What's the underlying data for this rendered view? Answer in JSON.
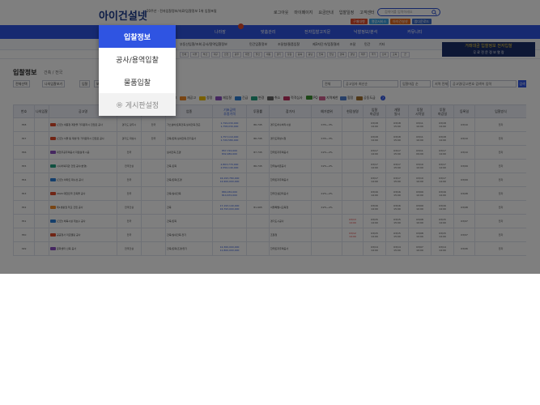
{
  "header": {
    "logo": "아이건설넷",
    "logo_sub": "20주년 · 전자입찰정보/자료/입찰정보 1위 입찰포털",
    "top_links": [
      "로그아웃",
      "마이페이지",
      "요금안내",
      "입찰일정",
      "고객센터"
    ],
    "search_placeholder": "검색어를 입력하세요",
    "chips": [
      {
        "label": "구매대행",
        "color": "#e04b2a"
      },
      {
        "label": "열람서비스",
        "color": "#3aa0e0"
      },
      {
        "label": "아이건설넷",
        "color": "#e06a20"
      },
      {
        "label": "앱다운로드",
        "color": "#3a6ac8"
      }
    ]
  },
  "nav": {
    "items": [
      "나라장",
      "맞춤관리",
      "전자입찰고지문",
      "낙찰정보/분석",
      "커뮤니티"
    ],
    "badge_color": "#e04b2a"
  },
  "subnav": {
    "items": [
      "부동산입찰/조회",
      "공사/용역입찰정보",
      "민간입찰정보",
      "조달청/물품입찰",
      "제3자단가/입찰결과",
      "조달",
      "민간",
      "기타"
    ],
    "regions": [
      "전체",
      "서울",
      "부산",
      "대구",
      "인천",
      "광주",
      "대전",
      "울산",
      "세종",
      "경기",
      "강원",
      "충북",
      "충남",
      "전북",
      "전남",
      "경북",
      "경남",
      "제주",
      "국가",
      "산하",
      "교육",
      "군"
    ]
  },
  "banner": {
    "line1": "거래대금 입찰정보 전자입찰",
    "line2": "무 료 전 문 정 보 열 람"
  },
  "page": {
    "title": "입찰정보",
    "breadcrumb": "건축 / 전국"
  },
  "toolbar": {
    "buttons": [
      "전체선택",
      "나의입찰보기",
      "입찰",
      "보기"
    ],
    "filters": [
      "전체",
      "공고일자 최신순",
      "입찰마감 순",
      "지역 전체",
      "공고명/공고번호 검색어 입력"
    ],
    "go_label": "검색"
  },
  "legend": [
    {
      "label": "공고",
      "color": "#e04b2a"
    },
    {
      "label": "재공고",
      "color": "#f08a28"
    },
    {
      "label": "정정",
      "color": "#f0c000"
    },
    {
      "label": "재입찰",
      "color": "#8a4ec0"
    },
    {
      "label": "긴급",
      "color": "#2a7fd6"
    },
    {
      "label": "변경",
      "color": "#20a080"
    },
    {
      "label": "취소",
      "color": "#666666"
    },
    {
      "label": "적격심사",
      "color": "#c03060"
    },
    {
      "label": "PQ",
      "color": "#3a9030"
    },
    {
      "label": "지역제한",
      "color": "#d06090"
    },
    {
      "label": "협정",
      "color": "#5080d0"
    },
    {
      "label": "공동도급",
      "color": "#a07030"
    }
  ],
  "table": {
    "columns": [
      "번호",
      "나의입찰",
      "공고명",
      "발주기관",
      "지역제한",
      "업종",
      "기초금액\n추정가격",
      "투찰률",
      "참가자",
      "예가범위",
      "현장설명",
      "입찰\n마감일",
      "개찰\n일시",
      "투찰\n시작일",
      "투찰\n마감일",
      "등록일",
      "입찰방식"
    ],
    "rows": [
      {
        "num": "358",
        "title": "[긴급] 세종청 계양을 가지원자시 진입로 공사",
        "org": "경기도 광주시",
        "region": "전국",
        "industry": "가스설비/토목건축,실내건축,철근",
        "price": "1,799,030,000\n1,758,030,000",
        "rate": "86.745",
        "participant": "경기도하수처리시설",
        "range": "±3%~3%",
        "explain": "",
        "due": "03/18\n14:00",
        "open": "03/18\n15:00",
        "bid_start": "03/11\n10:00",
        "bid_end": "03/18\n14:00",
        "reg": "03/10",
        "method": "전자"
      },
      {
        "num": "357",
        "title": "[긴급] 서울 동 재생 및 가지원자시 진입로 공사",
        "org": "경기도 화성시",
        "region": "전국",
        "industry": "건축/토목,실내건축,전기공사",
        "price": "1,757,110,000\n1,720,580,000",
        "rate": "86.745",
        "participant": "경기도화성시청",
        "range": "±3%~3%",
        "explain": "",
        "due": "03/18\n14:00",
        "open": "03/18\n15:00",
        "bid_start": "03/11\n10:00",
        "bid_end": "03/18\n14:00",
        "reg": "03/10",
        "method": "전자"
      },
      {
        "num": "356",
        "title": "대한주공주택공사 지점설계 시공",
        "org": "전국",
        "region": "",
        "industry": "실내건축,조경",
        "price": "857,720,000\n832,480,000",
        "rate": "87.745",
        "participant": "한국토지주택공사",
        "range": "±2%~2%",
        "explain": "",
        "due": "03/17\n14:00",
        "open": "03/17\n15:00",
        "bid_start": "03/11\n09:00",
        "bid_end": "03/17\n14:00",
        "reg": "03/10",
        "method": "전자"
      },
      {
        "num": "355",
        "title": "시니어복지관 건립 공사(변경)",
        "org": "전국건설",
        "region": "",
        "industry": "건축,토목",
        "price": "2,803,770,000\n2,550,140,000",
        "rate": "86.745",
        "participant": "한국농어촌공사",
        "range": "±2%~2%",
        "explain": "",
        "due": "03/17\n14:00",
        "open": "03/17\n15:00",
        "bid_start": "03/10\n10:00",
        "bid_end": "03/17\n14:00",
        "reg": "03/09",
        "method": "전자"
      },
      {
        "num": "354",
        "title": "[긴급] 아파트 대수선 공사",
        "org": "전국",
        "region": "",
        "industry": "건축/토목/조경",
        "price": "16,193,780,000\n14,900,000,000",
        "rate": "",
        "participant": "한국토지주택공사",
        "range": "",
        "explain": "",
        "due": "03/17\n14:00",
        "open": "03/17\n15:00",
        "bid_start": "03/10\n10:00",
        "bid_end": "03/17\n14:00",
        "reg": "03/09",
        "method": "전자"
      },
      {
        "num": "353",
        "title": "2024 대한민국 건축물 공사",
        "org": "전국",
        "region": "",
        "industry": "건축/실내건축",
        "price": "884,030,000\n814,670,000",
        "rate": "",
        "participant": "한국건설관리공사",
        "range": "±2%~2%",
        "explain": "",
        "due": "03/16\n14:00",
        "open": "03/16\n15:00",
        "bid_start": "03/09\n10:00",
        "bid_end": "03/16\n14:00",
        "reg": "03/08",
        "method": "전자"
      },
      {
        "num": "352",
        "title": "제1생활권 학교 건립 공사",
        "org": "전국건설",
        "region": "",
        "industry": "건축",
        "price": "17,193,140,000\n16,793,000,000",
        "rate": "81.995",
        "participant": "서울특별시교육청",
        "range": "±2%~2%",
        "explain": "",
        "due": "03/16\n14:00",
        "open": "03/16\n15:00",
        "bid_start": "03/09\n10:00",
        "bid_end": "03/16\n14:00",
        "reg": "03/08",
        "method": "전자"
      },
      {
        "num": "351",
        "title": "[긴급] 체육시설 개보수 공사",
        "org": "전국",
        "region": "",
        "industry": "건축/토목",
        "price": "",
        "rate": "",
        "participant": "경기도시공사",
        "range": "",
        "explain": "03/13\n14:00",
        "due": "03/15\n14:00",
        "open": "03/15\n15:00",
        "bid_start": "03/08\n10:00",
        "bid_end": "03/15\n14:00",
        "reg": "03/07",
        "method": "전자"
      },
      {
        "num": "350",
        "title": "공공청사 리모델링 공사",
        "org": "전국",
        "region": "",
        "industry": "건축/실내건축,전기",
        "price": "",
        "rate": "",
        "participant": "조달청",
        "range": "",
        "explain": "03/12\n14:00",
        "due": "03/15\n14:00",
        "open": "03/15\n15:00",
        "bid_start": "03/08\n10:00",
        "bid_end": "03/15\n14:00",
        "reg": "03/07",
        "method": "전자"
      },
      {
        "num": "349",
        "title": "문화센터 신축 공사",
        "org": "전국건설",
        "region": "",
        "industry": "건축/토목/조경/전기",
        "price": "12,360,000,000\n11,800,000,000",
        "rate": "",
        "participant": "한국토지주택공사",
        "range": "",
        "explain": "",
        "due": "03/14\n14:00",
        "open": "03/14\n15:00",
        "bid_start": "03/07\n10:00",
        "bid_end": "03/14\n14:00",
        "reg": "03/06",
        "method": "전자"
      }
    ]
  },
  "dropdown": {
    "items": [
      "입찰정보",
      "공사/용역입찰",
      "물품입찰",
      "게시판설정"
    ]
  }
}
